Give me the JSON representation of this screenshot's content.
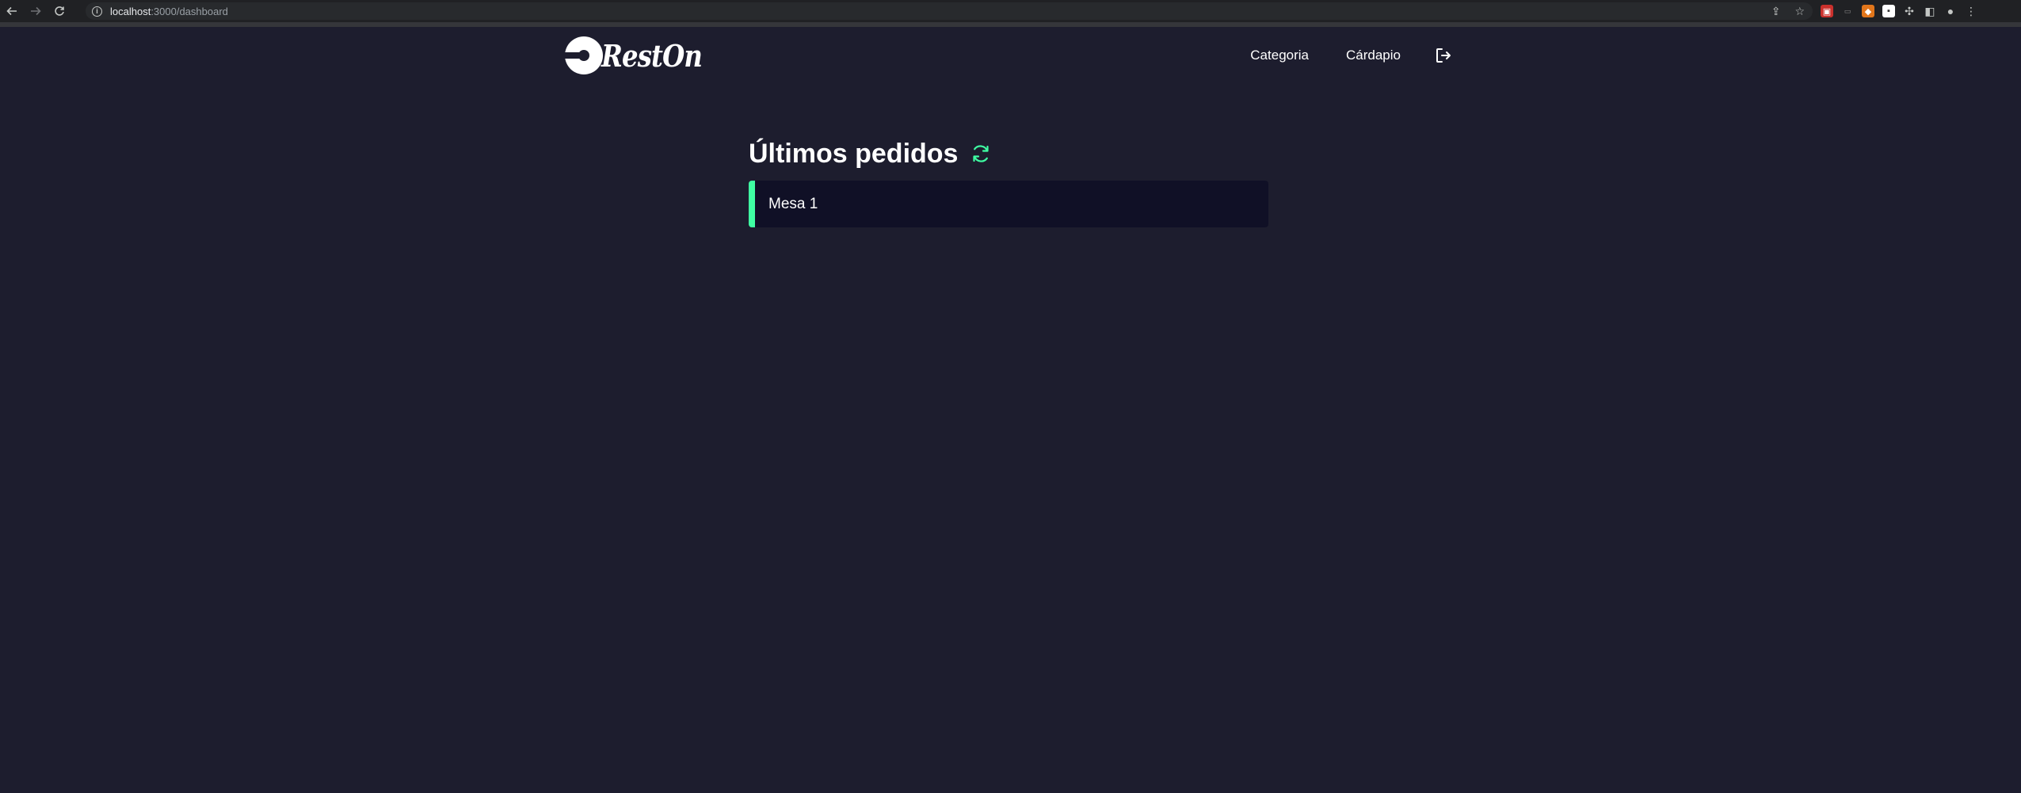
{
  "browser": {
    "url_host": "localhost",
    "url_path": ":3000/dashboard"
  },
  "app": {
    "logo_text": "RestOn",
    "nav": {
      "category_label": "Categoria",
      "menu_label": "Cárdapio"
    }
  },
  "dashboard": {
    "title": "Últimos pedidos",
    "orders": [
      {
        "label": "Mesa 1"
      }
    ]
  },
  "colors": {
    "background": "#1d1d2e",
    "card": "#101026",
    "accent_green": "#3fffa3"
  }
}
